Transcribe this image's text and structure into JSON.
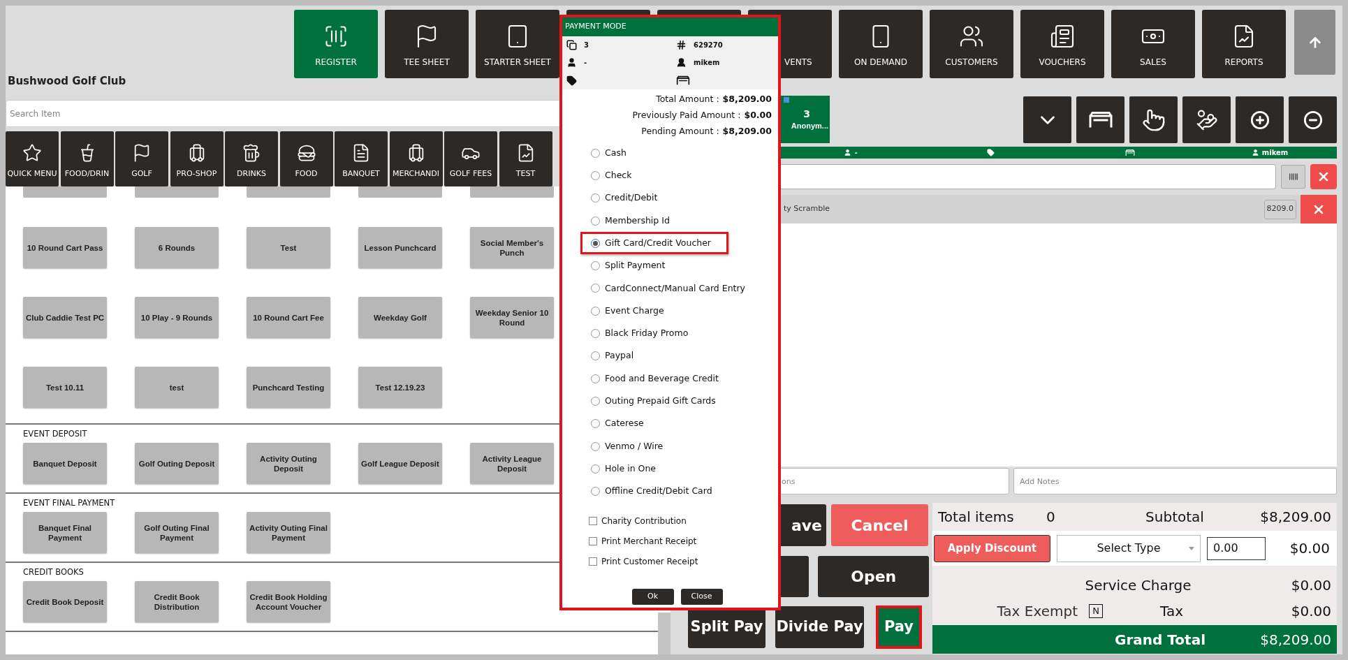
{
  "club_name": "Bushwood Golf Club",
  "nav": [
    {
      "label": "REGISTER",
      "selected": true
    },
    {
      "label": "TEE SHEET",
      "selected": false
    },
    {
      "label": "STARTER SHEET",
      "selected": false
    },
    {
      "selected": false
    },
    {
      "selected": false
    },
    {
      "label": "VENTS",
      "selected": false
    },
    {
      "label": "ON DEMAND",
      "selected": false
    },
    {
      "label": "CUSTOMERS",
      "selected": false
    },
    {
      "label": "VOUCHERS",
      "selected": false
    },
    {
      "label": "SALES",
      "selected": false
    },
    {
      "label": "REPORTS",
      "selected": false
    }
  ],
  "search": {
    "placeholder": "Search Item"
  },
  "categories": [
    "QUICK MENU",
    "FOOD/DRIN",
    "GOLF",
    "PRO-SHOP",
    "DRINKS",
    "FOOD",
    "BANQUET",
    "MERCHANDI",
    "GOLF FEES",
    "TEST"
  ],
  "items": [
    "10 Round Cart Pass",
    "6 Rounds",
    "Test",
    "Lesson Punchcard",
    "Social Member's Punch",
    "Club Caddie Test PC",
    "10 Play - 9 Rounds",
    "10 Round Cart Fee",
    "Weekday Golf",
    "Weekday Senior 10 Round",
    "Test 10.11",
    "test",
    "Punchcard Testing",
    "Test 12.19.23"
  ],
  "sections": [
    {
      "title": "EVENT DEPOSIT",
      "items": [
        "Banquet Deposit",
        "Golf Outing Deposit",
        "Activity Outing Deposit",
        "Golf League Deposit",
        "Activity League Deposit"
      ]
    },
    {
      "title": "EVENT FINAL PAYMENT",
      "items": [
        "Banquet Final Payment",
        "Golf Outing Final Payment",
        "Activity Outing Final Payment"
      ]
    },
    {
      "title": "CREDIT BOOKS",
      "items": [
        "Credit Book Deposit",
        "Credit Book Distribution",
        "Credit Book Holding Account Voucher"
      ]
    }
  ],
  "order_tab": {
    "number": "3",
    "name": "Anonym...",
    "selected": true
  },
  "info_bar": {
    "customer": "-",
    "user": "mikem"
  },
  "cart_items": [
    {
      "name": "ty Scramble",
      "price": "8209.0"
    }
  ],
  "notes": [
    {
      "placeholder": "ons"
    },
    {
      "placeholder": "Add Notes"
    }
  ],
  "actions": {
    "save": "ave",
    "cancel": "Cancel",
    "open": "Open",
    "split_pay": "Split Pay",
    "divide_pay": "Divide Pay",
    "pay": "Pay",
    "pay_highlighted": true
  },
  "summary": {
    "total_items_label": "Total items",
    "total_items": "0",
    "subtotal_label": "Subtotal",
    "subtotal": "$8,209.00",
    "apply_discount": "Apply Discount",
    "discount_type": "Select Type",
    "discount_value": "0.00",
    "discount_amount": "$0.00",
    "service_charge_label": "Service Charge",
    "service_charge": "$0.00",
    "tax_exempt_label": "Tax Exempt",
    "tax_exempt": "N",
    "tax_label": "Tax",
    "tax": "$0.00",
    "grand_total_label": "Grand Total",
    "grand_total": "$8,209.00"
  },
  "payment_modal": {
    "title": "PAYMENT MODE",
    "highlighted": true,
    "guests": "3",
    "ticket": "629270",
    "customer": "-",
    "user": "mikem",
    "amounts": [
      {
        "label": "Total Amount :",
        "value": "$8,209.00"
      },
      {
        "label": "Previously Paid Amount :",
        "value": "$0.00"
      },
      {
        "label": "Pending Amount :",
        "value": "$8,209.00"
      }
    ],
    "options": [
      {
        "label": "Cash",
        "selected": false,
        "highlighted": false
      },
      {
        "label": "Check",
        "selected": false,
        "highlighted": false
      },
      {
        "label": "Credit/Debit",
        "selected": false,
        "highlighted": false
      },
      {
        "label": "Membership Id",
        "selected": false,
        "highlighted": false
      },
      {
        "label": "Gift Card/Credit Voucher",
        "selected": true,
        "highlighted": true
      },
      {
        "label": "Split Payment",
        "selected": false,
        "highlighted": false
      },
      {
        "label": "CardConnect/Manual Card Entry",
        "selected": false,
        "highlighted": false
      },
      {
        "label": "Event Charge",
        "selected": false,
        "highlighted": false
      },
      {
        "label": "Black Friday Promo",
        "selected": false,
        "highlighted": false
      },
      {
        "label": "Paypal",
        "selected": false,
        "highlighted": false
      },
      {
        "label": "Food and Beverage Credit",
        "selected": false,
        "highlighted": false
      },
      {
        "label": "Outing Prepaid Gift Cards",
        "selected": false,
        "highlighted": false
      },
      {
        "label": "Caterese",
        "selected": false,
        "highlighted": false
      },
      {
        "label": "Venmo / Wire",
        "selected": false,
        "highlighted": false
      },
      {
        "label": "Hole in One",
        "selected": false,
        "highlighted": false
      },
      {
        "label": "Offline Credit/Debit Card",
        "selected": false,
        "highlighted": false
      }
    ],
    "checkboxes": [
      {
        "label": "Charity Contribution",
        "checked": false
      },
      {
        "label": "Print Merchant Receipt",
        "checked": false
      },
      {
        "label": "Print Customer Receipt",
        "checked": false
      }
    ],
    "buttons": [
      "Ok",
      "Close"
    ]
  }
}
